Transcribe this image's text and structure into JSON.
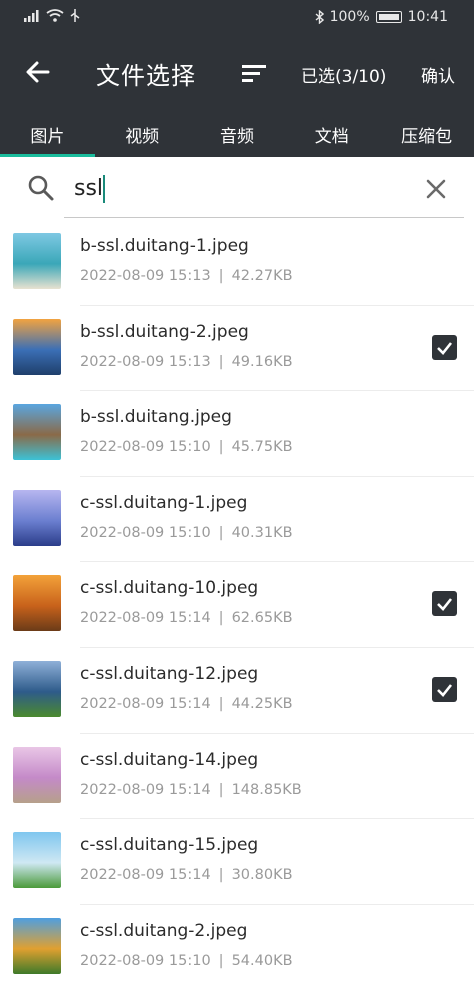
{
  "status": {
    "battery": "100%",
    "time": "10:41"
  },
  "header": {
    "title": "文件选择",
    "selected_count": "已选(3/10)",
    "confirm": "确认"
  },
  "tabs": [
    {
      "label": "图片",
      "active": true
    },
    {
      "label": "视频",
      "active": false
    },
    {
      "label": "音频",
      "active": false
    },
    {
      "label": "文档",
      "active": false
    },
    {
      "label": "压缩包",
      "active": false
    }
  ],
  "search": {
    "value": "ssl",
    "placeholder": ""
  },
  "files": [
    {
      "name": "b-ssl.duitang-1.jpeg",
      "date": "2022-08-09 15:13",
      "size": "42.27KB",
      "checked": false,
      "colors": [
        "#7ec8e3",
        "#3aa7b8",
        "#e8e2d0"
      ]
    },
    {
      "name": "b-ssl.duitang-2.jpeg",
      "date": "2022-08-09 15:13",
      "size": "49.16KB",
      "checked": true,
      "colors": [
        "#f2a340",
        "#3b6fb6",
        "#1f3f6b"
      ]
    },
    {
      "name": "b-ssl.duitang.jpeg",
      "date": "2022-08-09 15:10",
      "size": "45.75KB",
      "checked": false,
      "colors": [
        "#5aa6e0",
        "#8a6a48",
        "#3cc2d6"
      ]
    },
    {
      "name": "c-ssl.duitang-1.jpeg",
      "date": "2022-08-09 15:10",
      "size": "40.31KB",
      "checked": false,
      "colors": [
        "#b7b6f0",
        "#6b7fd0",
        "#2b3d8a"
      ]
    },
    {
      "name": "c-ssl.duitang-10.jpeg",
      "date": "2022-08-09 15:14",
      "size": "62.65KB",
      "checked": true,
      "colors": [
        "#f3a23a",
        "#c8621b",
        "#6b3b18"
      ]
    },
    {
      "name": "c-ssl.duitang-12.jpeg",
      "date": "2022-08-09 15:14",
      "size": "44.25KB",
      "checked": true,
      "colors": [
        "#8fb0d8",
        "#2e5b8a",
        "#4b8a2e"
      ]
    },
    {
      "name": "c-ssl.duitang-14.jpeg",
      "date": "2022-08-09 15:14",
      "size": "148.85KB",
      "checked": false,
      "colors": [
        "#e9c6e6",
        "#c48ac8",
        "#b6a08a"
      ]
    },
    {
      "name": "c-ssl.duitang-15.jpeg",
      "date": "2022-08-09 15:14",
      "size": "30.80KB",
      "checked": false,
      "colors": [
        "#7fc6ef",
        "#cfe8f3",
        "#4b9a3a"
      ]
    },
    {
      "name": "c-ssl.duitang-2.jpeg",
      "date": "2022-08-09 15:10",
      "size": "54.40KB",
      "checked": false,
      "colors": [
        "#4f9fe0",
        "#e0a030",
        "#3e7a2a"
      ]
    }
  ]
}
